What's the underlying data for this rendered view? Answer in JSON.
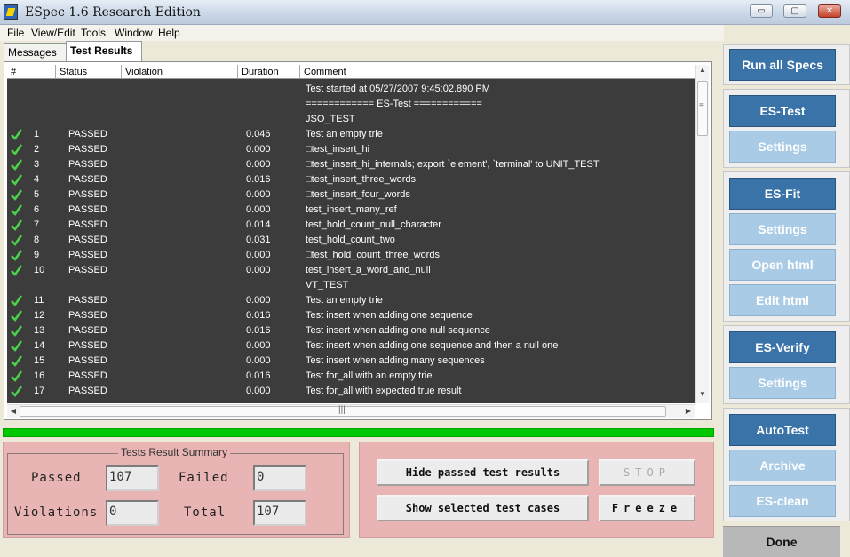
{
  "window": {
    "title": "ESpec 1.6 Research Edition",
    "min_glyph": "▭",
    "max_glyph": "▢",
    "close_glyph": "✕"
  },
  "menu": [
    "File",
    "View/Edit",
    "Tools",
    "Window",
    "Help"
  ],
  "tabs": [
    {
      "label": "Messages",
      "active": false
    },
    {
      "label": "Test Results",
      "active": true
    }
  ],
  "table": {
    "columns": [
      "#",
      "Status",
      "Violation",
      "Duration",
      "Comment"
    ],
    "rows": [
      {
        "num": "",
        "status": "",
        "violation": "",
        "duration": "",
        "comment": "Test started at 05/27/2007 9:45:02.890 PM",
        "check": false
      },
      {
        "num": "",
        "status": "",
        "violation": "",
        "duration": "",
        "comment": "============ ES-Test ============",
        "check": false
      },
      {
        "num": "",
        "status": "",
        "violation": "",
        "duration": "",
        "comment": "JSO_TEST",
        "check": false
      },
      {
        "num": "1",
        "status": "PASSED",
        "violation": "",
        "duration": "0.046",
        "comment": "Test an empty trie",
        "check": true
      },
      {
        "num": "2",
        "status": "PASSED",
        "violation": "",
        "duration": "0.000",
        "comment": "□test_insert_hi",
        "check": true
      },
      {
        "num": "3",
        "status": "PASSED",
        "violation": "",
        "duration": "0.000",
        "comment": "□test_insert_hi_internals; export `element', `terminal' to UNIT_TEST",
        "check": true
      },
      {
        "num": "4",
        "status": "PASSED",
        "violation": "",
        "duration": "0.016",
        "comment": "□test_insert_three_words",
        "check": true
      },
      {
        "num": "5",
        "status": "PASSED",
        "violation": "",
        "duration": "0.000",
        "comment": "□test_insert_four_words",
        "check": true
      },
      {
        "num": "6",
        "status": "PASSED",
        "violation": "",
        "duration": "0.000",
        "comment": "test_insert_many_ref",
        "check": true
      },
      {
        "num": "7",
        "status": "PASSED",
        "violation": "",
        "duration": "0.014",
        "comment": "test_hold_count_null_character",
        "check": true
      },
      {
        "num": "8",
        "status": "PASSED",
        "violation": "",
        "duration": "0.031",
        "comment": "test_hold_count_two",
        "check": true
      },
      {
        "num": "9",
        "status": "PASSED",
        "violation": "",
        "duration": "0.000",
        "comment": "□test_hold_count_three_words",
        "check": true
      },
      {
        "num": "10",
        "status": "PASSED",
        "violation": "",
        "duration": "0.000",
        "comment": "test_insert_a_word_and_null",
        "check": true
      },
      {
        "num": "",
        "status": "",
        "violation": "",
        "duration": "",
        "comment": "VT_TEST",
        "check": false
      },
      {
        "num": "11",
        "status": "PASSED",
        "violation": "",
        "duration": "0.000",
        "comment": "Test an empty trie",
        "check": true
      },
      {
        "num": "12",
        "status": "PASSED",
        "violation": "",
        "duration": "0.016",
        "comment": "Test insert when adding one sequence",
        "check": true
      },
      {
        "num": "13",
        "status": "PASSED",
        "violation": "",
        "duration": "0.016",
        "comment": "Test insert when adding one null sequence",
        "check": true
      },
      {
        "num": "14",
        "status": "PASSED",
        "violation": "",
        "duration": "0.000",
        "comment": "Test insert when adding one sequence and then a null one",
        "check": true
      },
      {
        "num": "15",
        "status": "PASSED",
        "violation": "",
        "duration": "0.000",
        "comment": "Test insert when adding many sequences",
        "check": true
      },
      {
        "num": "16",
        "status": "PASSED",
        "violation": "",
        "duration": "0.016",
        "comment": "Test for_all with an empty trie",
        "check": true
      },
      {
        "num": "17",
        "status": "PASSED",
        "violation": "",
        "duration": "0.000",
        "comment": "Test for_all with expected true result",
        "check": true
      }
    ],
    "scroll_thumb_glyph": "≡",
    "hscroll_thumb_glyph": "|||"
  },
  "progress": {
    "value": 1.0,
    "color": "#00c800"
  },
  "summary": {
    "legend": "Tests Result Summary",
    "passed_label": "Passed",
    "passed_value": "107",
    "failed_label": "Failed",
    "failed_value": "0",
    "violations_label": "Violations",
    "violations_value": "0",
    "total_label": "Total",
    "total_value": "107"
  },
  "controls": {
    "hide_passed": "Hide passed test results",
    "stop": "STOP",
    "show_selected": "Show selected test cases",
    "freeze": "Freeze"
  },
  "sidebar": {
    "run_all": "Run all Specs",
    "es_test": "ES-Test",
    "es_test_settings": "Settings",
    "es_fit": "ES-Fit",
    "es_fit_settings": "Settings",
    "open_html": "Open html",
    "edit_html": "Edit html",
    "es_verify": "ES-Verify",
    "es_verify_settings": "Settings",
    "autotest": "AutoTest",
    "archive": "Archive",
    "es_clean": "ES-clean",
    "done": "Done"
  },
  "colors": {
    "sidebar_dark": "#3a73a8",
    "sidebar_light": "#a9cbe6",
    "summary_bg": "#e8b4b4",
    "results_bg": "#3c3c3c"
  }
}
